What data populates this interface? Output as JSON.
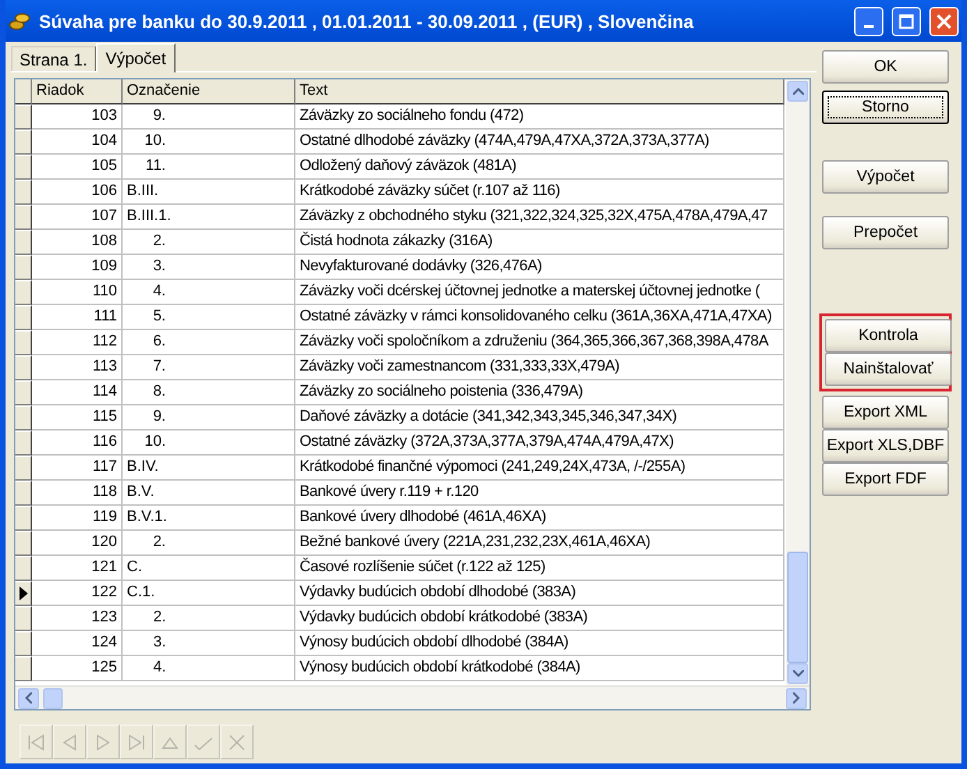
{
  "window": {
    "title": "Súvaha pre banku do 30.9.2011 , 01.01.2011 - 30.09.2011 , (EUR) , Slovenčina"
  },
  "tabs": [
    {
      "label": "Strana 1.",
      "selected": false
    },
    {
      "label": "Výpočet",
      "selected": true
    }
  ],
  "table": {
    "columns": [
      "Riadok",
      "Označenie",
      "Text"
    ],
    "rows": [
      {
        "riadok": "103",
        "oznacenie": "9.",
        "kind": "item",
        "text": "Záväzky zo sociálneho fondu (472)",
        "selected": false
      },
      {
        "riadok": "104",
        "oznacenie": "10.",
        "kind": "item",
        "text": "Ostatné dlhodobé záväzky (474A,479A,47XA,372A,373A,377A)",
        "selected": false
      },
      {
        "riadok": "105",
        "oznacenie": "11.",
        "kind": "item",
        "text": "Odložený daňový záväzok (481A)",
        "selected": false
      },
      {
        "riadok": "106",
        "oznacenie": "B.III.",
        "kind": "section",
        "text": "Krátkodobé záväzky súčet (r.107 až 116)",
        "selected": false
      },
      {
        "riadok": "107",
        "oznacenie": "B.III.1.",
        "kind": "section",
        "text": "Záväzky z obchodného styku (321,322,324,325,32X,475A,478A,479A,47",
        "selected": false
      },
      {
        "riadok": "108",
        "oznacenie": "2.",
        "kind": "item",
        "text": "Čistá hodnota zákazky (316A)",
        "selected": false
      },
      {
        "riadok": "109",
        "oznacenie": "3.",
        "kind": "item",
        "text": "Nevyfakturované dodávky (326,476A)",
        "selected": false
      },
      {
        "riadok": "110",
        "oznacenie": "4.",
        "kind": "item",
        "text": "Záväzky voči dcérskej účtovnej jednotke a materskej účtovnej jednotke (",
        "selected": false
      },
      {
        "riadok": "111",
        "oznacenie": "5.",
        "kind": "item",
        "text": "Ostatné záväzky v rámci konsolidovaného celku (361A,36XA,471A,47XA)",
        "selected": false
      },
      {
        "riadok": "112",
        "oznacenie": "6.",
        "kind": "item",
        "text": "Záväzky voči spoločníkom a združeniu (364,365,366,367,368,398A,478A",
        "selected": false
      },
      {
        "riadok": "113",
        "oznacenie": "7.",
        "kind": "item",
        "text": "Záväzky voči zamestnancom (331,333,33X,479A)",
        "selected": false
      },
      {
        "riadok": "114",
        "oznacenie": "8.",
        "kind": "item",
        "text": "Záväzky zo sociálneho poistenia (336,479A)",
        "selected": false
      },
      {
        "riadok": "115",
        "oznacenie": "9.",
        "kind": "item",
        "text": "Daňové záväzky a dotácie (341,342,343,345,346,347,34X)",
        "selected": false
      },
      {
        "riadok": "116",
        "oznacenie": "10.",
        "kind": "item",
        "text": "Ostatné záväzky (372A,373A,377A,379A,474A,479A,47X)",
        "selected": false
      },
      {
        "riadok": "117",
        "oznacenie": "B.IV.",
        "kind": "section",
        "text": "Krátkodobé finančné výpomoci (241,249,24X,473A, /-/255A)",
        "selected": false
      },
      {
        "riadok": "118",
        "oznacenie": "B.V.",
        "kind": "section",
        "text": "Bankové úvery r.119 + r.120",
        "selected": false
      },
      {
        "riadok": "119",
        "oznacenie": "B.V.1.",
        "kind": "section",
        "text": "Bankové úvery dlhodobé (461A,46XA)",
        "selected": false
      },
      {
        "riadok": "120",
        "oznacenie": "2.",
        "kind": "item",
        "text": "Bežné bankové úvery (221A,231,232,23X,461A,46XA)",
        "selected": false
      },
      {
        "riadok": "121",
        "oznacenie": "C.",
        "kind": "section",
        "text": "Časové rozlíšenie súčet (r.122 až 125)",
        "selected": false
      },
      {
        "riadok": "122",
        "oznacenie": "C.1.",
        "kind": "section",
        "text": "Výdavky budúcich období dlhodobé (383A)",
        "selected": true
      },
      {
        "riadok": "123",
        "oznacenie": "2.",
        "kind": "subitem",
        "text": "Výdavky budúcich období krátkodobé (383A)",
        "selected": false
      },
      {
        "riadok": "124",
        "oznacenie": "3.",
        "kind": "subitem",
        "text": "Výnosy budúcich období dlhodobé (384A)",
        "selected": false
      },
      {
        "riadok": "125",
        "oznacenie": "4.",
        "kind": "subitem",
        "text": "Výnosy budúcich období krátkodobé (384A)",
        "selected": false
      }
    ]
  },
  "navigator": [
    {
      "kind": "first",
      "disabled": true
    },
    {
      "kind": "prior",
      "disabled": true
    },
    {
      "kind": "next",
      "disabled": true
    },
    {
      "kind": "last",
      "disabled": true
    },
    {
      "kind": "edit",
      "disabled": true
    },
    {
      "kind": "post",
      "disabled": true
    },
    {
      "kind": "cancel",
      "disabled": true
    }
  ],
  "button_groups": [
    {
      "highlighted": false,
      "buttons": [
        {
          "label": "OK",
          "focused": false
        },
        {
          "label": "Storno",
          "focused": true
        }
      ]
    },
    {
      "highlighted": false,
      "buttons": [
        {
          "label": "Výpočet",
          "focused": false
        },
        {
          "label": "Prepočet",
          "focused": false
        }
      ]
    },
    {
      "highlighted": true,
      "buttons": [
        {
          "label": "Kontrola",
          "focused": false
        },
        {
          "label": "Nainštalovať",
          "focused": false
        }
      ]
    },
    {
      "highlighted": false,
      "buttons": [
        {
          "label": "Export XML",
          "focused": false
        },
        {
          "label": "Export XLS,DBF",
          "focused": false
        },
        {
          "label": "Export FDF",
          "focused": false
        }
      ]
    }
  ]
}
